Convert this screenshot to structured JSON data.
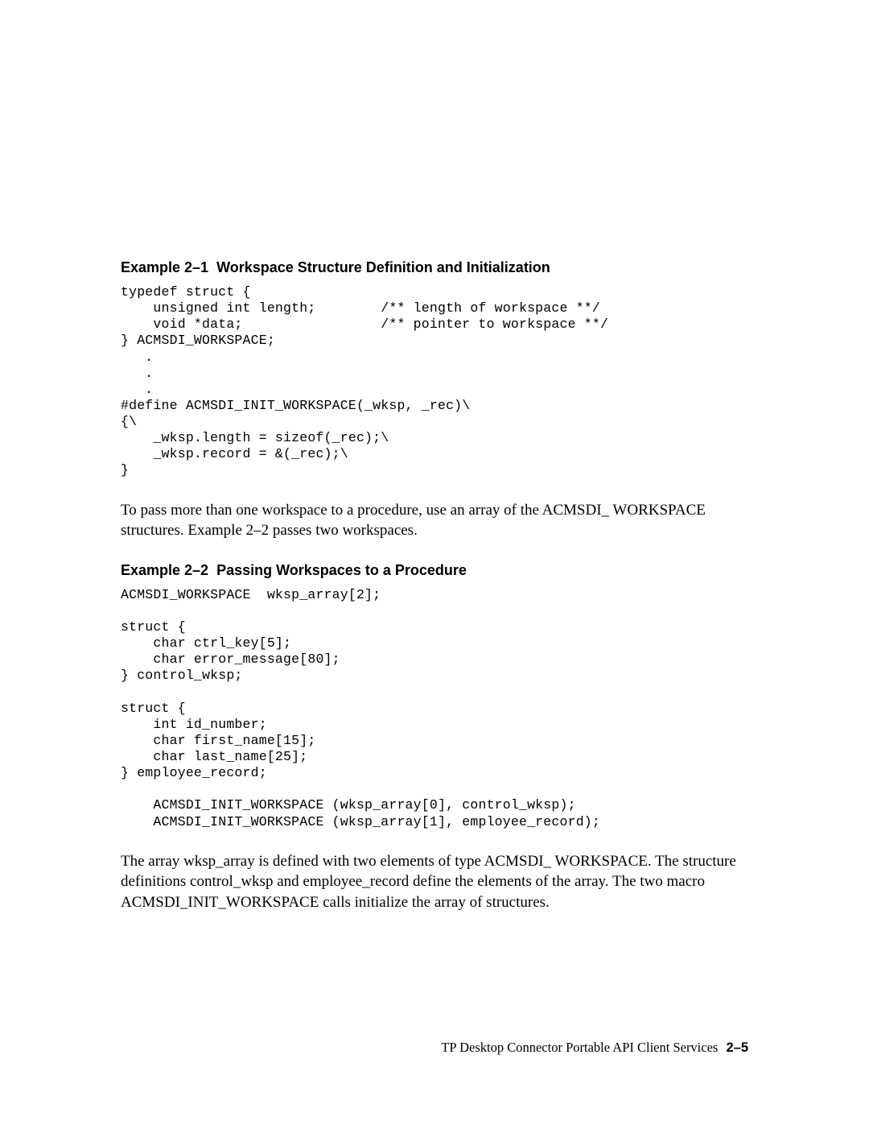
{
  "example1": {
    "title_num": "Example 2–1",
    "title_text": "Workspace Structure Definition and Initialization",
    "code": "typedef struct {\n    unsigned int length;        /** length of workspace **/\n    void *data;                 /** pointer to workspace **/\n} ACMSDI_WORKSPACE;\n   .\n   .\n   .\n#define ACMSDI_INIT_WORKSPACE(_wksp, _rec)\\\n{\\\n    _wksp.length = sizeof(_rec);\\\n    _wksp.record = &(_rec);\\\n}"
  },
  "para1": "To pass more than one workspace to a procedure, use an array of the ACMSDI_ WORKSPACE structures. Example 2–2 passes two workspaces.",
  "example2": {
    "title_num": "Example 2–2",
    "title_text": "Passing Workspaces to a Procedure",
    "code": "ACMSDI_WORKSPACE  wksp_array[2];\n\nstruct {\n    char ctrl_key[5];\n    char error_message[80];\n} control_wksp;\n\nstruct {\n    int id_number;\n    char first_name[15];\n    char last_name[25];\n} employee_record;\n\n    ACMSDI_INIT_WORKSPACE (wksp_array[0], control_wksp);\n    ACMSDI_INIT_WORKSPACE (wksp_array[1], employee_record);"
  },
  "para2": "The array wksp_array is defined with two elements of type ACMSDI_ WORKSPACE. The structure definitions control_wksp and employee_record define the elements of the array. The two macro ACMSDI_INIT_WORKSPACE calls initialize the array of structures.",
  "footer": {
    "label": "TP Desktop Connector Portable API Client Services",
    "page": "2–5"
  }
}
